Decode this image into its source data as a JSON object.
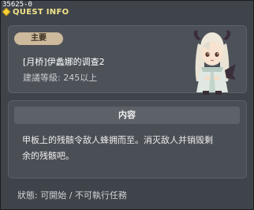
{
  "window": {
    "quest_id": "35625-0",
    "title": "QUEST INFO"
  },
  "quest": {
    "badge": "主要",
    "name": "[月桥]伊蠡娜的调查2",
    "level_requirement": "建議等級: 245以上"
  },
  "details": {
    "header": "内容",
    "description_line1": "甲板上的残骸令敌人蜂拥而至。消灭敌人并销毁剩",
    "description_line2": "余的残骸吧。"
  },
  "status": "狀態: 可開始 / 不可執行任務",
  "colors": {
    "background": "#3f434a",
    "title_text": "#f3e48b",
    "badge": "#cdb99b",
    "panel": "#4d5158"
  }
}
